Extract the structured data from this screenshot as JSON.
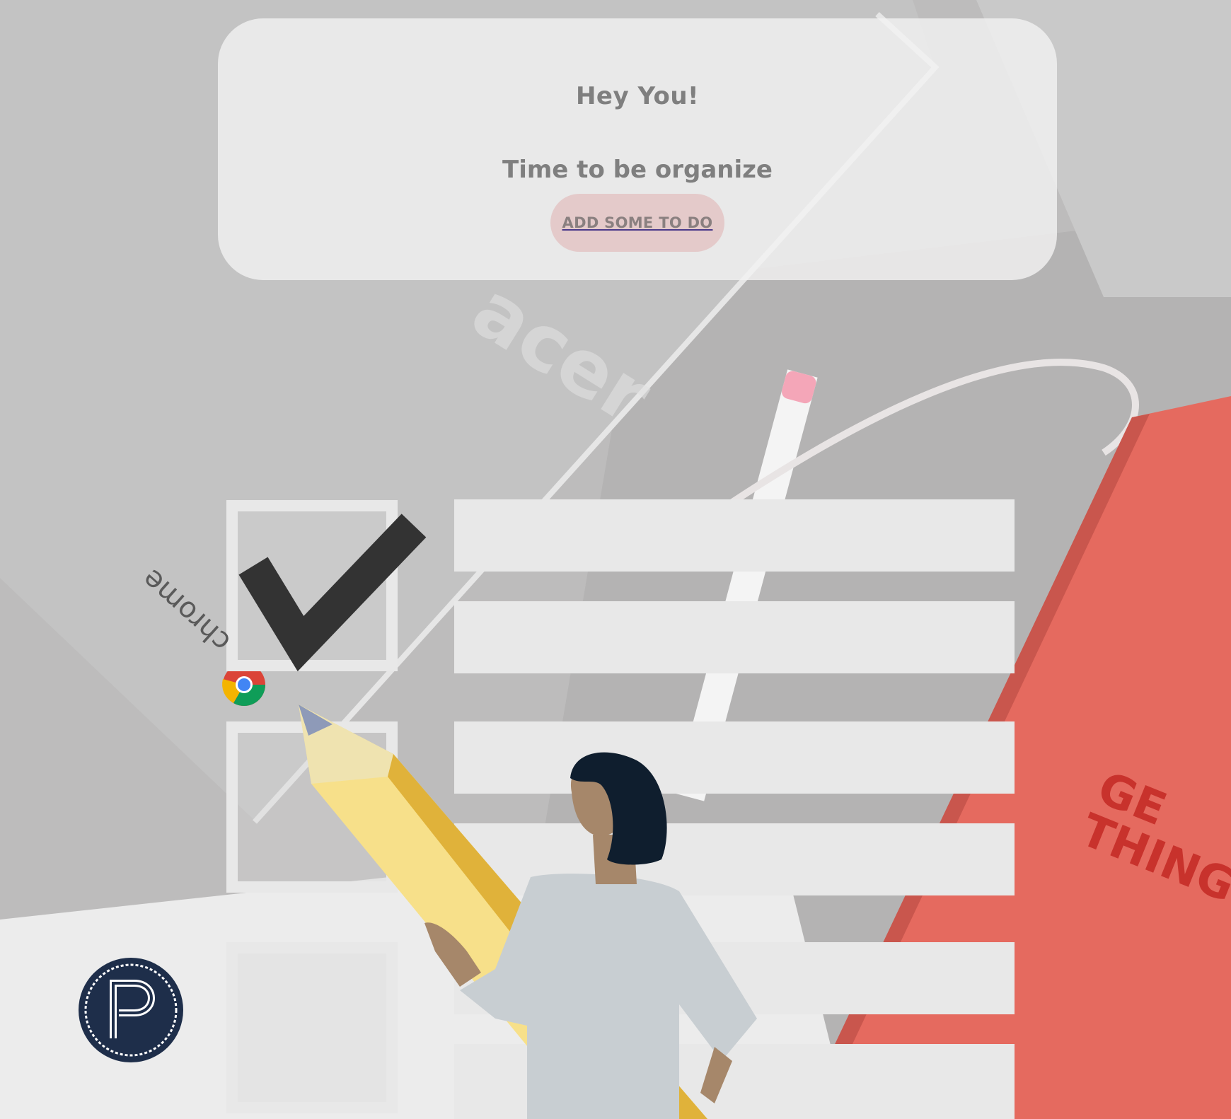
{
  "hero": {
    "greeting": "Hey You!",
    "tagline": "Time to be organize",
    "cta_label": "ADD SOME TO DO"
  },
  "background": {
    "laptop_brand_text": "chrome",
    "book_title_lines": [
      "GE",
      "THING"
    ]
  },
  "checklist_rows": [
    {
      "checked": true
    },
    {
      "checked": false
    },
    {
      "checked": false
    }
  ],
  "colors": {
    "card_background": "#f2f2f2",
    "card_text": "#7f7f7f",
    "cta_background": "#e3c6c6",
    "checkmark": "#333333",
    "checklist_bars": "#e8e8e8",
    "book_red": "#e56a5f",
    "pencil_yellow": "#f7e08a",
    "pencil_shade": "#e0b23a",
    "figure_shirt": "#c8ced2",
    "figure_hair": "#0f1e2e",
    "figure_skin": "#a6876a",
    "logo_navy": "#1e2e4a"
  },
  "icons": [
    "checkmark-icon",
    "chrome-logo-icon",
    "p-badge-icon",
    "pencil-illustration",
    "person-illustration"
  ]
}
